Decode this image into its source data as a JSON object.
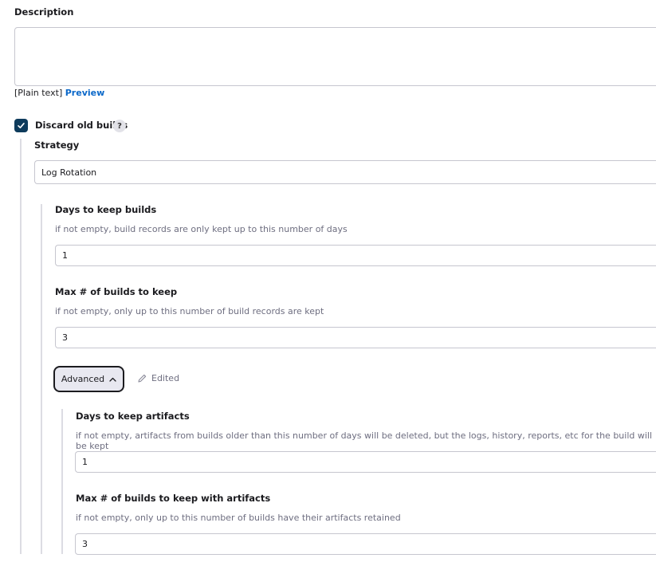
{
  "description": {
    "label": "Description",
    "value": "",
    "format_prefix": "[Plain text]",
    "preview_link": "Preview"
  },
  "discard": {
    "checked": true,
    "label": "Discard old builds",
    "help_button": "?",
    "strategy_label": "Strategy",
    "strategy_value": "Log Rotation",
    "days_label": "Days to keep builds",
    "days_help": "if not empty, build records are only kept up to this number of days",
    "days_value": "1",
    "max_label": "Max # of builds to keep",
    "max_help": "if not empty, only up to this number of build records are kept",
    "max_value": "3",
    "advanced_button": "Advanced",
    "edited_label": "Edited",
    "artifact_days_label": "Days to keep artifacts",
    "artifact_days_help": "if not empty, artifacts from builds older than this number of days will be deleted, but the logs, history, reports, etc for the build will be kept",
    "artifact_days_value": "1",
    "artifact_max_label": "Max # of builds to keep with artifacts",
    "artifact_max_help": "if not empty, only up to this number of builds have their artifacts retained",
    "artifact_max_value": "3"
  },
  "colors": {
    "accent": "#0b5394",
    "checkbox": "#0e3b5c",
    "button_bg": "#e8e8f0"
  }
}
